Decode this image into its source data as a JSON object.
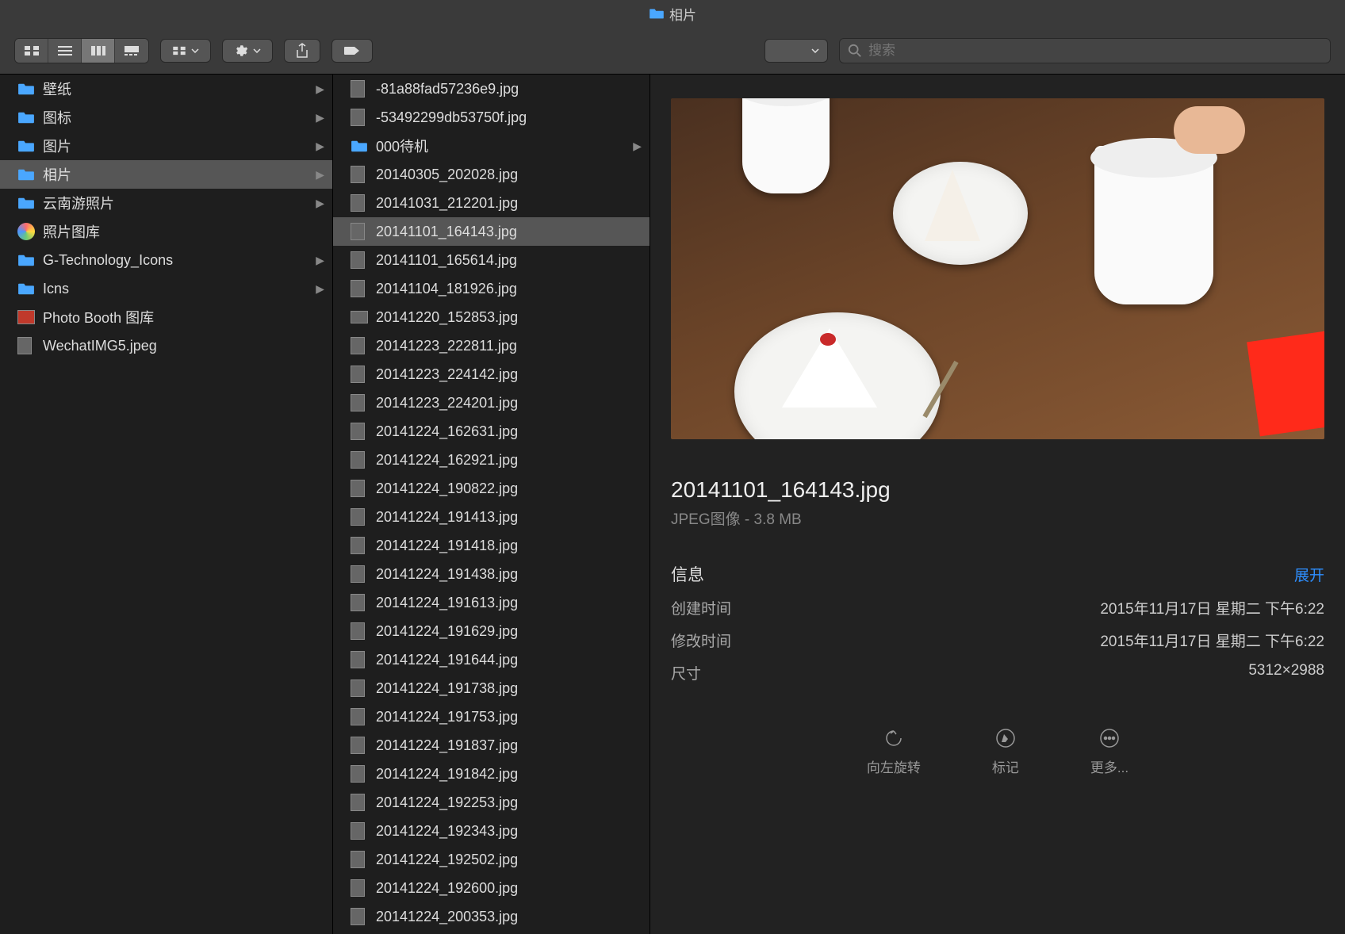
{
  "window": {
    "title": "相片"
  },
  "search": {
    "placeholder": "搜索"
  },
  "col1": [
    {
      "name": "壁纸",
      "kind": "folder",
      "chev": true
    },
    {
      "name": "图标",
      "kind": "folder",
      "chev": true
    },
    {
      "name": "图片",
      "kind": "folder",
      "chev": true
    },
    {
      "name": "相片",
      "kind": "folder",
      "chev": true,
      "selected": true
    },
    {
      "name": "云南游照片",
      "kind": "folder",
      "chev": true
    },
    {
      "name": "照片图库",
      "kind": "photoslib"
    },
    {
      "name": "G-Technology_Icons",
      "kind": "folder",
      "chev": true
    },
    {
      "name": "Icns",
      "kind": "folder",
      "chev": true
    },
    {
      "name": "Photo Booth 图库",
      "kind": "photobooth"
    },
    {
      "name": "WechatIMG5.jpeg",
      "kind": "image"
    }
  ],
  "col2": [
    {
      "name": "-81a88fad57236e9.jpg",
      "kind": "image"
    },
    {
      "name": "-53492299db53750f.jpg",
      "kind": "image"
    },
    {
      "name": "000待机",
      "kind": "folder",
      "chev": true
    },
    {
      "name": "20140305_202028.jpg",
      "kind": "image"
    },
    {
      "name": "20141031_212201.jpg",
      "kind": "image"
    },
    {
      "name": "20141101_164143.jpg",
      "kind": "image",
      "selected": true
    },
    {
      "name": "20141101_165614.jpg",
      "kind": "image"
    },
    {
      "name": "20141104_181926.jpg",
      "kind": "image"
    },
    {
      "name": "20141220_152853.jpg",
      "kind": "image-wide"
    },
    {
      "name": "20141223_222811.jpg",
      "kind": "image"
    },
    {
      "name": "20141223_224142.jpg",
      "kind": "image"
    },
    {
      "name": "20141223_224201.jpg",
      "kind": "image"
    },
    {
      "name": "20141224_162631.jpg",
      "kind": "image"
    },
    {
      "name": "20141224_162921.jpg",
      "kind": "image"
    },
    {
      "name": "20141224_190822.jpg",
      "kind": "image"
    },
    {
      "name": "20141224_191413.jpg",
      "kind": "image"
    },
    {
      "name": "20141224_191418.jpg",
      "kind": "image"
    },
    {
      "name": "20141224_191438.jpg",
      "kind": "image"
    },
    {
      "name": "20141224_191613.jpg",
      "kind": "image"
    },
    {
      "name": "20141224_191629.jpg",
      "kind": "image"
    },
    {
      "name": "20141224_191644.jpg",
      "kind": "image"
    },
    {
      "name": "20141224_191738.jpg",
      "kind": "image"
    },
    {
      "name": "20141224_191753.jpg",
      "kind": "image"
    },
    {
      "name": "20141224_191837.jpg",
      "kind": "image"
    },
    {
      "name": "20141224_191842.jpg",
      "kind": "image"
    },
    {
      "name": "20141224_192253.jpg",
      "kind": "image"
    },
    {
      "name": "20141224_192343.jpg",
      "kind": "image"
    },
    {
      "name": "20141224_192502.jpg",
      "kind": "image"
    },
    {
      "name": "20141224_192600.jpg",
      "kind": "image"
    },
    {
      "name": "20141224_200353.jpg",
      "kind": "image"
    }
  ],
  "preview": {
    "filename": "20141101_164143.jpg",
    "subtitle": "JPEG图像 - 3.8 MB",
    "info_label": "信息",
    "expand_label": "展开",
    "rows": {
      "created_label": "创建时间",
      "created_value": "2015年11月17日 星期二 下午6:22",
      "modified_label": "修改时间",
      "modified_value": "2015年11月17日 星期二 下午6:22",
      "dimensions_label": "尺寸",
      "dimensions_value": "5312×2988"
    },
    "actions": {
      "rotate": "向左旋转",
      "markup": "标记",
      "more": "更多..."
    }
  }
}
